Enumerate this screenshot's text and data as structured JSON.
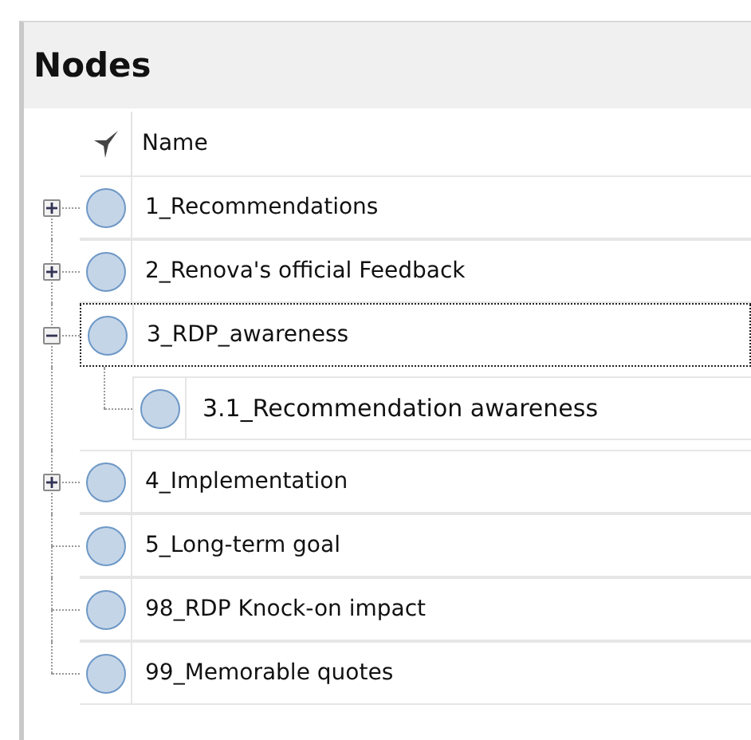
{
  "panel": {
    "title": "Nodes"
  },
  "columns": [
    {
      "label": "Name"
    }
  ],
  "nodes": [
    {
      "name": "1_Recommendations",
      "kind": "collapsed",
      "selected": false
    },
    {
      "name": "2_Renova's official Feedback",
      "kind": "collapsed",
      "selected": false
    },
    {
      "name": "3_RDP_awareness",
      "kind": "expanded",
      "selected": true,
      "children": [
        {
          "name": "3.1_Recommendation awareness",
          "kind": "leaf",
          "selected": false
        }
      ]
    },
    {
      "name": "4_Implementation",
      "kind": "collapsed",
      "selected": false
    },
    {
      "name": "5_Long-term goal",
      "kind": "leaf",
      "selected": false
    },
    {
      "name": "98_RDP Knock-on impact",
      "kind": "leaf",
      "selected": false
    },
    {
      "name": "99_Memorable quotes",
      "kind": "leaf",
      "selected": false
    }
  ]
}
